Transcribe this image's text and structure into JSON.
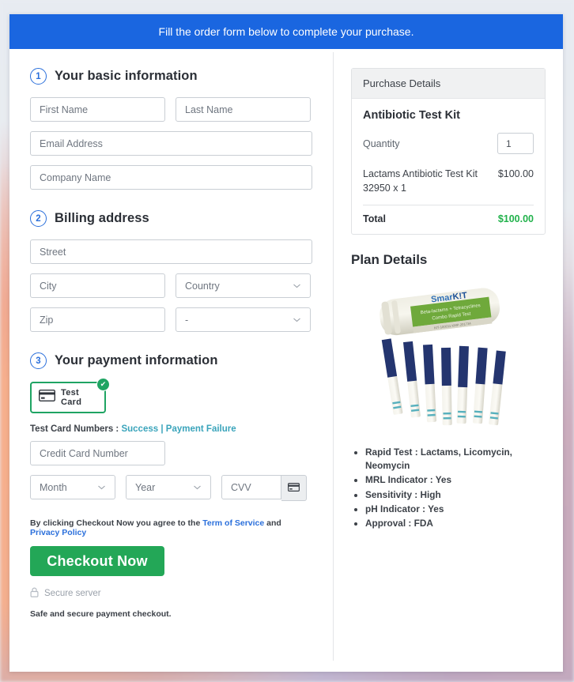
{
  "banner": {
    "text": "Fill the order form below to complete your purchase."
  },
  "steps": [
    {
      "num": "1",
      "title": "Your basic information"
    },
    {
      "num": "2",
      "title": "Billing address"
    },
    {
      "num": "3",
      "title": "Your payment information"
    }
  ],
  "basic": {
    "first_name_placeholder": "First Name",
    "last_name_placeholder": "Last Name",
    "email_placeholder": "Email Address",
    "company_placeholder": "Company Name"
  },
  "billing": {
    "street_placeholder": "Street",
    "city_placeholder": "City",
    "country_value": "Country",
    "zip_placeholder": "Zip",
    "state_value": "-"
  },
  "payment": {
    "tile_label": "Test Card",
    "tile_icon": "credit-card-icon",
    "tile_badge_icon": "check-circle-icon",
    "test_numbers_label": "Test Card Numbers :",
    "success_link": "Success",
    "separator": "|",
    "failure_link": "Payment Failure",
    "card_number_placeholder": "Credit Card Number",
    "month_value": "Month",
    "year_value": "Year",
    "cvv_placeholder": "CVV",
    "cvv_icon": "credit-card-icon"
  },
  "footer": {
    "agree_prefix": "By clicking Checkout Now you agree to the",
    "terms_link": "Term of Service",
    "agree_and": "and",
    "privacy_link": "Privacy Policy",
    "checkout_label": "Checkout Now",
    "secure_icon": "lock-icon",
    "secure_label": "Secure server",
    "safe_text": "Safe and secure payment checkout."
  },
  "purchase": {
    "panel_title": "Purchase Details",
    "product_name": "Antibiotic Test Kit",
    "quantity_label": "Quantity",
    "quantity_value": "1",
    "line_item_name": "Lactams Antibiotic Test Kit 32950 x 1",
    "line_item_price": "$100.00",
    "total_label": "Total",
    "total_value": "$100.00"
  },
  "plan": {
    "title": "Plan Details",
    "image_alt": "antibiotic-test-kit-photo",
    "product_brand": "SmarKIT",
    "product_label_line1": "Beta-lactams + Tetracyclines",
    "product_label_line2": "Combo Rapid Test",
    "features": [
      "Rapid Test : Lactams, Licomycin, Neomycin",
      "MRL Indicator : Yes",
      "Sensitivity : High",
      "pH Indicator : Yes",
      "Approval : FDA"
    ]
  },
  "colors": {
    "banner_blue": "#1a66e0",
    "accent_green": "#23a757",
    "total_green": "#22b24c",
    "link_teal": "#3aa4bb",
    "link_blue": "#2a6fdb"
  }
}
